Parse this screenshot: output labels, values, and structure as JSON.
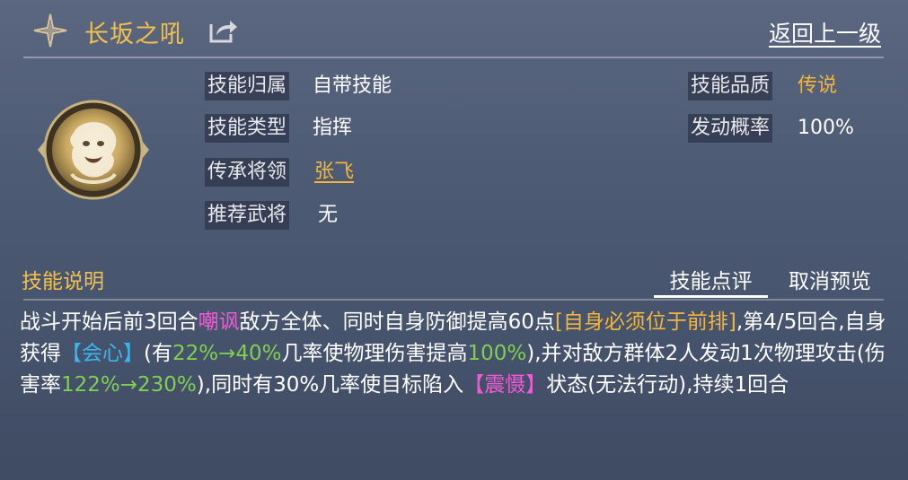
{
  "header": {
    "title": "长坂之吼",
    "back_label": "返回上一级"
  },
  "info": {
    "belong": {
      "label": "技能归属",
      "value": "自带技能"
    },
    "type": {
      "label": "技能类型",
      "value": "指挥"
    },
    "inherit": {
      "label": "传承将领",
      "value": "张飞"
    },
    "recommend": {
      "label": "推荐武将",
      "value": "无"
    },
    "quality": {
      "label": "技能品质",
      "value": "传说"
    },
    "chance": {
      "label": "发动概率",
      "value": "100%"
    }
  },
  "section": {
    "title": "技能说明",
    "tab_comment": "技能点评",
    "tab_cancel": "取消预览"
  },
  "description": {
    "s1": "战斗开始后前3回合",
    "k1": "嘲讽",
    "s2": "敌方全体、同时自身防御提高60点",
    "k2": "[自身必须位于前排]",
    "s3": ",第4/5回合,自身获得",
    "k3": "【会心】",
    "s4": "(有",
    "k4": "22%→40%",
    "s5": "几率使物理伤害提高",
    "k5": "100%",
    "s6": "),并对敌方群体2人发动1次物理攻击(伤害率",
    "k6": "122%→230%",
    "s7": "),同时有30%几率使目标陷入",
    "k7": "【震慑】",
    "s8": "状态(无法行动),持续1回合"
  },
  "colors": {
    "title_gold": "#f3c14a",
    "keyword_pink": "#f15ad6",
    "keyword_gold": "#f3b53a",
    "keyword_blue": "#37b7f0",
    "keyword_green": "#7ed14f"
  },
  "icons": [
    "star-ornament-icon",
    "share-icon",
    "roaring-beast-skill-icon"
  ]
}
